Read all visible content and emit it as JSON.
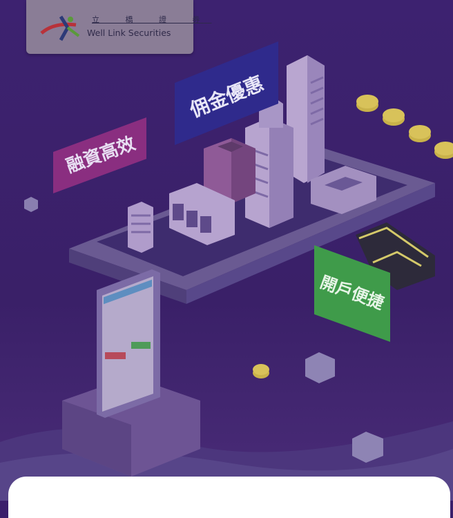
{
  "brand": {
    "name_cn": "立 橋 證 券",
    "name_en": "Well Link Securities"
  },
  "badges": {
    "financing": "融資高效",
    "commission": "佣金優惠",
    "account_opening": "開戶便捷"
  },
  "colors": {
    "background": "#3b1f6b",
    "financing_badge": "#8a2e80",
    "commission_badge": "#2f2a8c",
    "account_badge": "#3f9b4a",
    "coin": "#c9b24a",
    "sheet": "#ffffff"
  }
}
